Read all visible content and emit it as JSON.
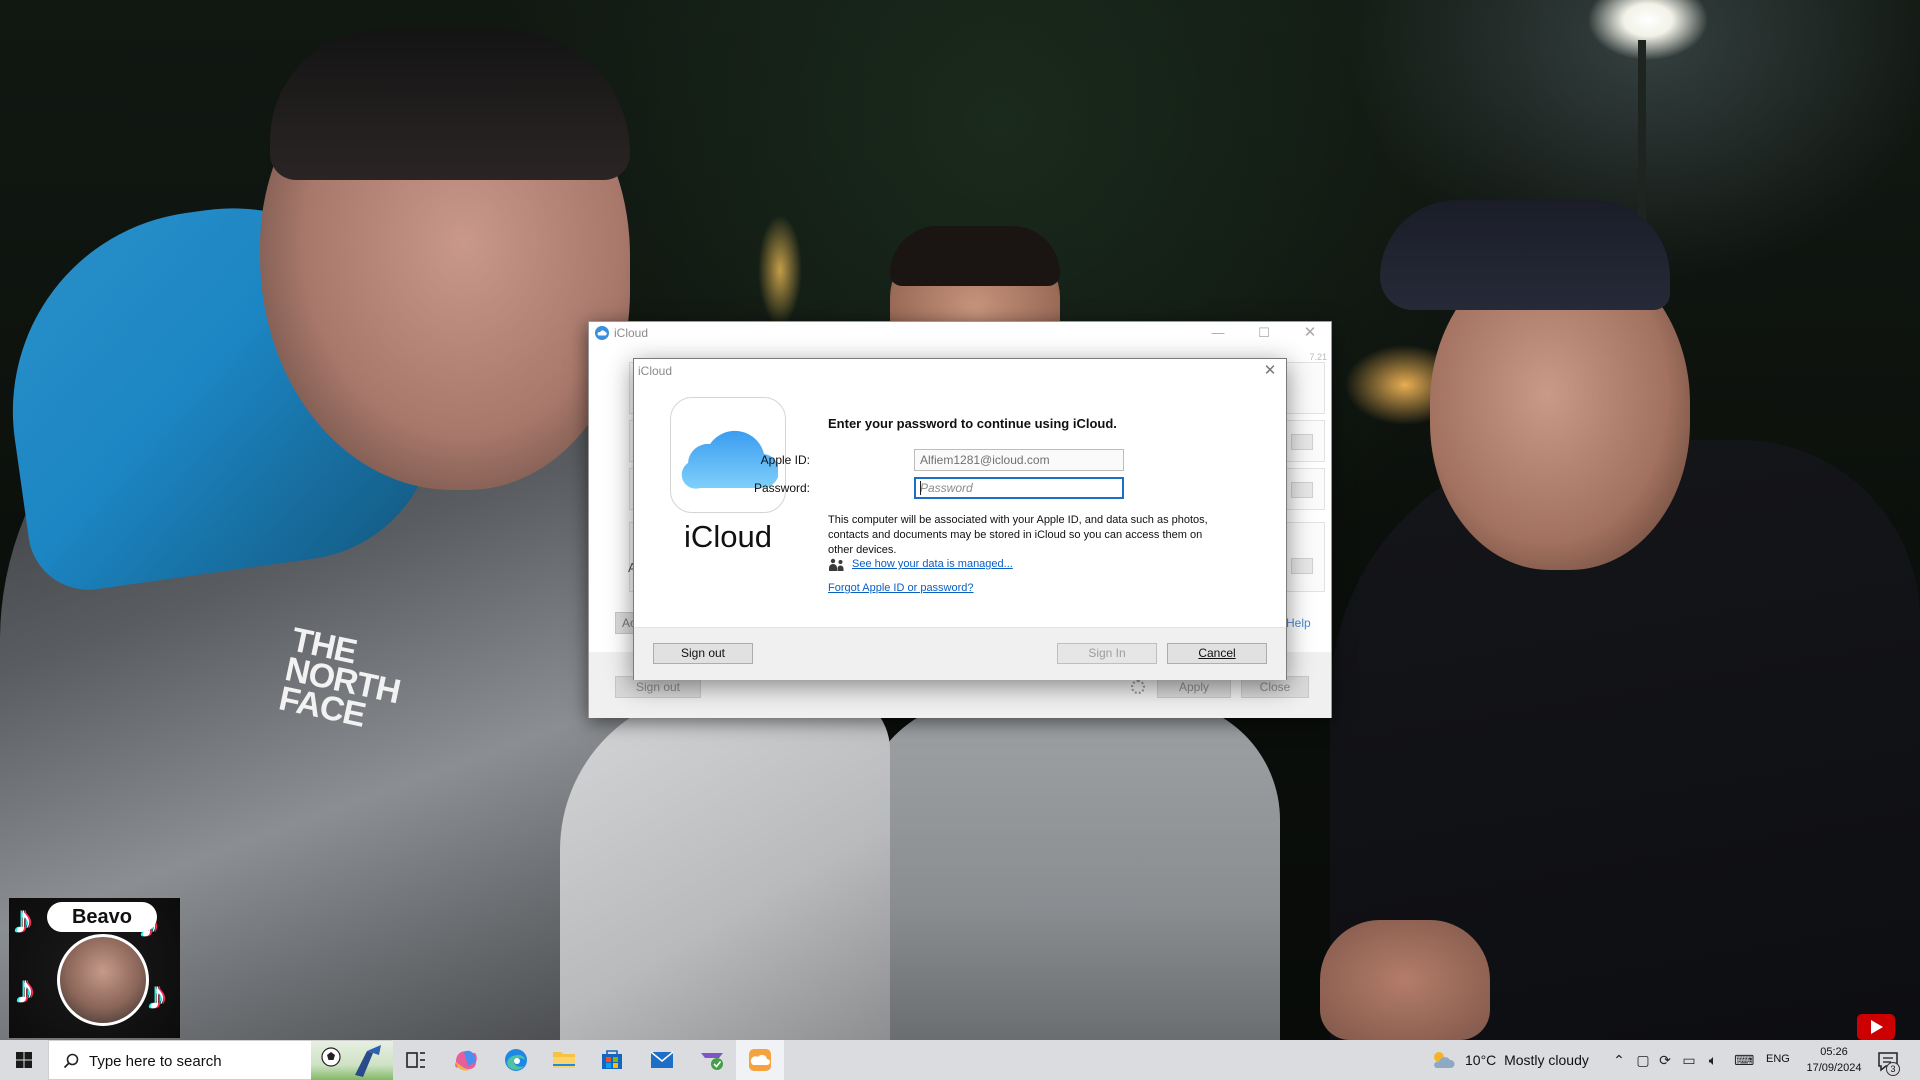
{
  "outer_window": {
    "title": "iCloud",
    "version": "7.21",
    "hidden_letter": "A",
    "account_button_label": "Ac",
    "help_link": "Help",
    "buttons": {
      "sign_out": "Sign out",
      "apply": "Apply",
      "close": "Close"
    },
    "caption": {
      "minimize": "—",
      "maximize": "☐",
      "close": "✕"
    }
  },
  "dialog": {
    "title": "iCloud",
    "close_glyph": "✕",
    "brand": "iCloud",
    "heading": "Enter your password to continue using iCloud.",
    "fields": {
      "apple_id_label": "Apple ID:",
      "apple_id_value": "Alfiem1281@icloud.com",
      "password_label": "Password:",
      "password_placeholder": "Password"
    },
    "body": "This computer will be associated with your Apple ID, and data such as photos, contacts and documents may be stored in iCloud so you can access them on other devices.",
    "privacy_link": "See how your data is managed...",
    "forgot_link": "Forgot Apple ID or password?",
    "buttons": {
      "sign_out": "Sign out",
      "sign_in": "Sign In",
      "cancel": "Cancel"
    }
  },
  "background": {
    "jacket_logo": "THE NORTH FACE"
  },
  "overlay": {
    "streamer_name": "Beavo"
  },
  "taskbar": {
    "search_placeholder": "Type here to search",
    "weather": {
      "temperature": "10°C",
      "condition": "Mostly cloudy"
    },
    "language": "ENG",
    "time": "05:26",
    "date": "17/09/2024",
    "notification_count": "3",
    "icons": [
      "windows-start-icon",
      "search-icon",
      "task-view-icon",
      "copilot-icon",
      "edge-icon",
      "file-explorer-icon",
      "microsoft-store-icon",
      "mail-icon",
      "snip-icon",
      "icloud-icon"
    ]
  },
  "colors": {
    "accent": "#1a6fc8",
    "link": "#0a5fc4",
    "taskbar": "#dadcdf",
    "dialog_footer": "#f0f0f0"
  }
}
